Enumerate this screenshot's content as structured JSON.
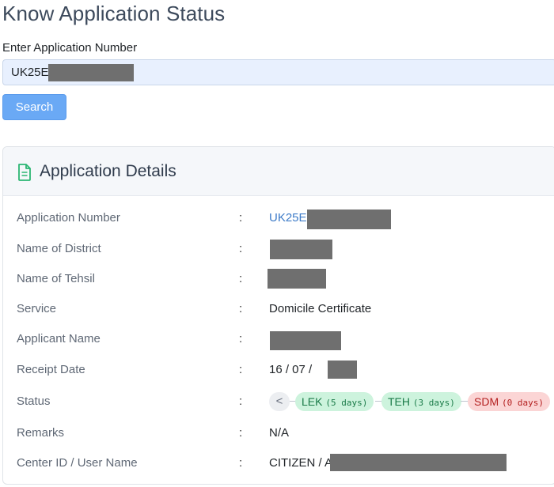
{
  "page": {
    "title": "Know Application Status"
  },
  "search": {
    "label": "Enter Application Number",
    "value": "UK25E",
    "button_label": "Search"
  },
  "details": {
    "title": "Application Details",
    "icon": "document-icon",
    "colon": ":",
    "rows": [
      {
        "label": "Application Number",
        "value": "UK25E"
      },
      {
        "label": "Name of District",
        "value": ""
      },
      {
        "label": "Name of Tehsil",
        "value": ""
      },
      {
        "label": "Service",
        "value": "Domicile Certificate"
      },
      {
        "label": "Applicant Name",
        "value": ""
      },
      {
        "label": "Receipt Date",
        "value": "16 / 07 /"
      },
      {
        "label": "Status",
        "value": ""
      },
      {
        "label": "Remarks",
        "value": "N/A"
      },
      {
        "label": "Center ID / User Name",
        "value": "CITIZEN / A"
      }
    ],
    "status_prev": "<",
    "status_steps": [
      {
        "code": "LEK",
        "days": "(5 days)",
        "state": "done",
        "color": "#cdf3dd"
      },
      {
        "code": "TEH",
        "days": "(3 days)",
        "state": "done",
        "color": "#cdf3dd"
      },
      {
        "code": "SDM",
        "days": "(0 days)",
        "state": "current",
        "color": "#fbd5d5"
      }
    ]
  }
}
